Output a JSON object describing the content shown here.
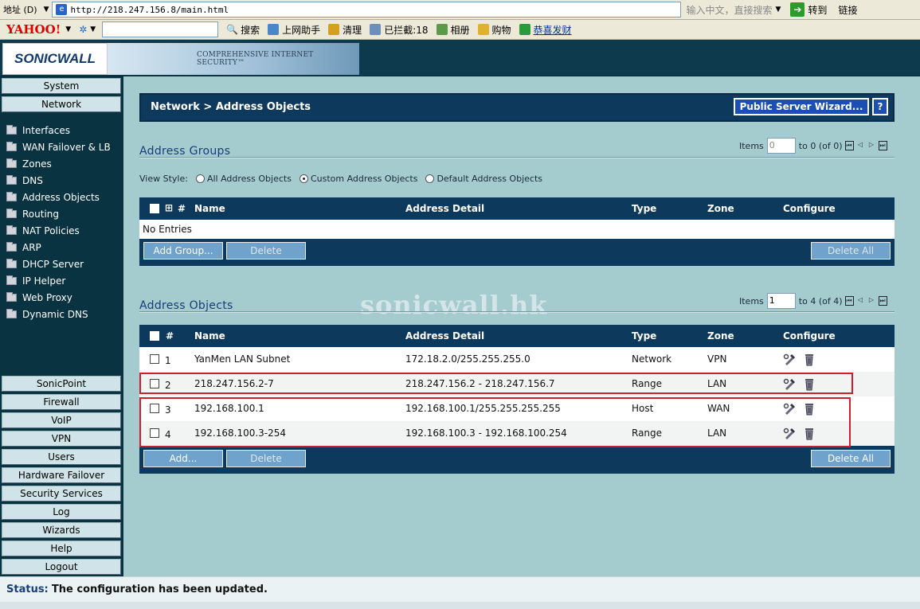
{
  "browser": {
    "address_label": "地址 (D)",
    "url": "http://218.247.156.8/main.html",
    "search_hint": "输入中文，直接搜索",
    "go_label": "转到",
    "links_label": "链接"
  },
  "toolbar": {
    "yahoo": "YAHOO!",
    "search_label": "搜索",
    "assistant": "上网助手",
    "clean": "清理",
    "blocked": "已拦截:18",
    "album": "相册",
    "shopping": "购物",
    "offer": "恭喜发财"
  },
  "header": {
    "logo": "SONICWALL",
    "tagline": "COMPREHENSIVE INTERNET SECURITY™"
  },
  "nav": {
    "top": [
      "System",
      "Network"
    ],
    "network_items": [
      "Interfaces",
      "WAN Failover & LB",
      "Zones",
      "DNS",
      "Address Objects",
      "Routing",
      "NAT Policies",
      "ARP",
      "DHCP Server",
      "IP Helper",
      "Web Proxy",
      "Dynamic DNS"
    ],
    "bottom": [
      "SonicPoint",
      "Firewall",
      "VoIP",
      "VPN",
      "Users",
      "Hardware Failover",
      "Security Services",
      "Log",
      "Wizards",
      "Help",
      "Logout"
    ]
  },
  "page": {
    "title": "Network > Address Objects",
    "wizard_button": "Public Server Wizard...",
    "help_button": "?",
    "watermark": "sonicwall.hk"
  },
  "groups": {
    "heading": "Address Groups",
    "items_label": "Items",
    "items_value": "0",
    "range_text": "to 0 (of 0)",
    "view_style_label": "View Style:",
    "view_options": [
      "All Address Objects",
      "Custom Address Objects",
      "Default Address Objects"
    ],
    "selected_view": "Custom Address Objects",
    "columns": {
      "num": "#",
      "name": "Name",
      "detail": "Address Detail",
      "type": "Type",
      "zone": "Zone",
      "configure": "Configure"
    },
    "empty_text": "No Entries",
    "add_button": "Add Group...",
    "delete_button": "Delete",
    "delete_all_button": "Delete All"
  },
  "objects": {
    "heading": "Address Objects",
    "items_label": "Items",
    "items_value": "1",
    "range_text": "to 4 (of 4)",
    "columns": {
      "num": "#",
      "name": "Name",
      "detail": "Address Detail",
      "type": "Type",
      "zone": "Zone",
      "configure": "Configure"
    },
    "rows": [
      {
        "num": "1",
        "name": "YanMen LAN Subnet",
        "detail": "172.18.2.0/255.255.255.0",
        "type": "Network",
        "zone": "VPN"
      },
      {
        "num": "2",
        "name": "218.247.156.2-7",
        "detail": "218.247.156.2 - 218.247.156.7",
        "type": "Range",
        "zone": "LAN"
      },
      {
        "num": "3",
        "name": "192.168.100.1",
        "detail": "192.168.100.1/255.255.255.255",
        "type": "Host",
        "zone": "WAN"
      },
      {
        "num": "4",
        "name": "192.168.100.3-254",
        "detail": "192.168.100.3 - 192.168.100.254",
        "type": "Range",
        "zone": "LAN"
      }
    ],
    "add_button": "Add...",
    "delete_button": "Delete",
    "delete_all_button": "Delete All"
  },
  "status": {
    "label": "Status:",
    "text": "The configuration has been updated."
  }
}
